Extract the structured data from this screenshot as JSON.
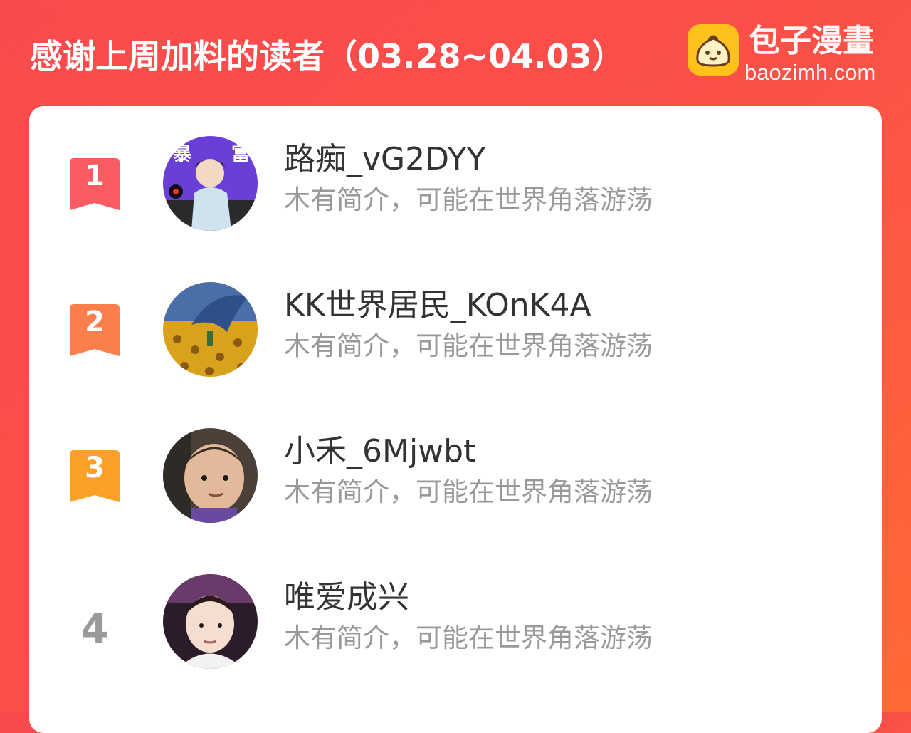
{
  "header": {
    "title": "感谢上周加料的读者（03.28~04.03）"
  },
  "logo": {
    "name": "包子漫畫",
    "url": "baozimh.com",
    "icon": "bun-icon",
    "color": "#ffc21a"
  },
  "colors": {
    "background_start": "#fb4a4d",
    "background_end": "#ff6a35",
    "rank1": "#f95c60",
    "rank2": "#fb7f4c",
    "rank3": "#fca028",
    "rank_plain": "#9a9a9a"
  },
  "readers": [
    {
      "rank": "1",
      "name": "路痴_vG2DYY",
      "bio": "木有简介，可能在世界角落游荡"
    },
    {
      "rank": "2",
      "name": "KK世界居民_KOnK4A",
      "bio": "木有简介，可能在世界角落游荡"
    },
    {
      "rank": "3",
      "name": "小禾_6Mjwbt",
      "bio": "木有简介，可能在世界角落游荡"
    },
    {
      "rank": "4",
      "name": "唯爱成兴",
      "bio": "木有简介，可能在世界角落游荡"
    }
  ]
}
